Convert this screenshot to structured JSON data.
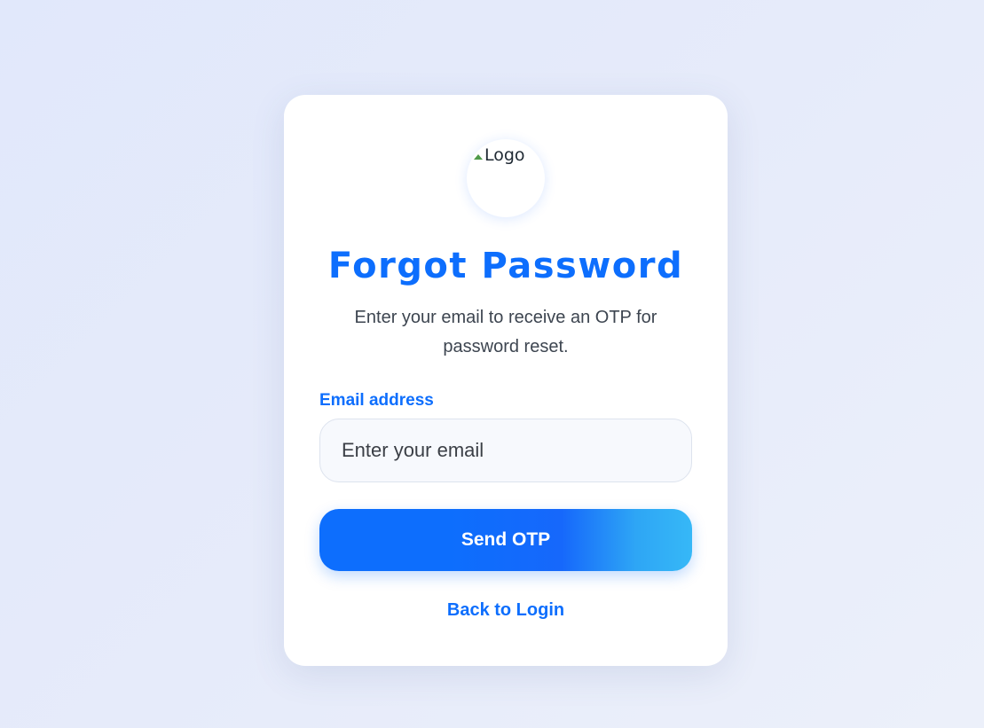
{
  "logo": {
    "alt_text": "Logo",
    "icon": "broken-image-icon"
  },
  "title": "Forgot Password",
  "subtitle": "Enter your email to receive an OTP for password reset.",
  "email_field": {
    "label": "Email address",
    "placeholder": "Enter your email",
    "value": ""
  },
  "send_button_label": "Send OTP",
  "back_link_label": "Back to Login",
  "colors": {
    "accent": "#0d6efd",
    "button_gradient_end": "#36b8f7",
    "background": "#e4eafa",
    "card": "#ffffff"
  }
}
